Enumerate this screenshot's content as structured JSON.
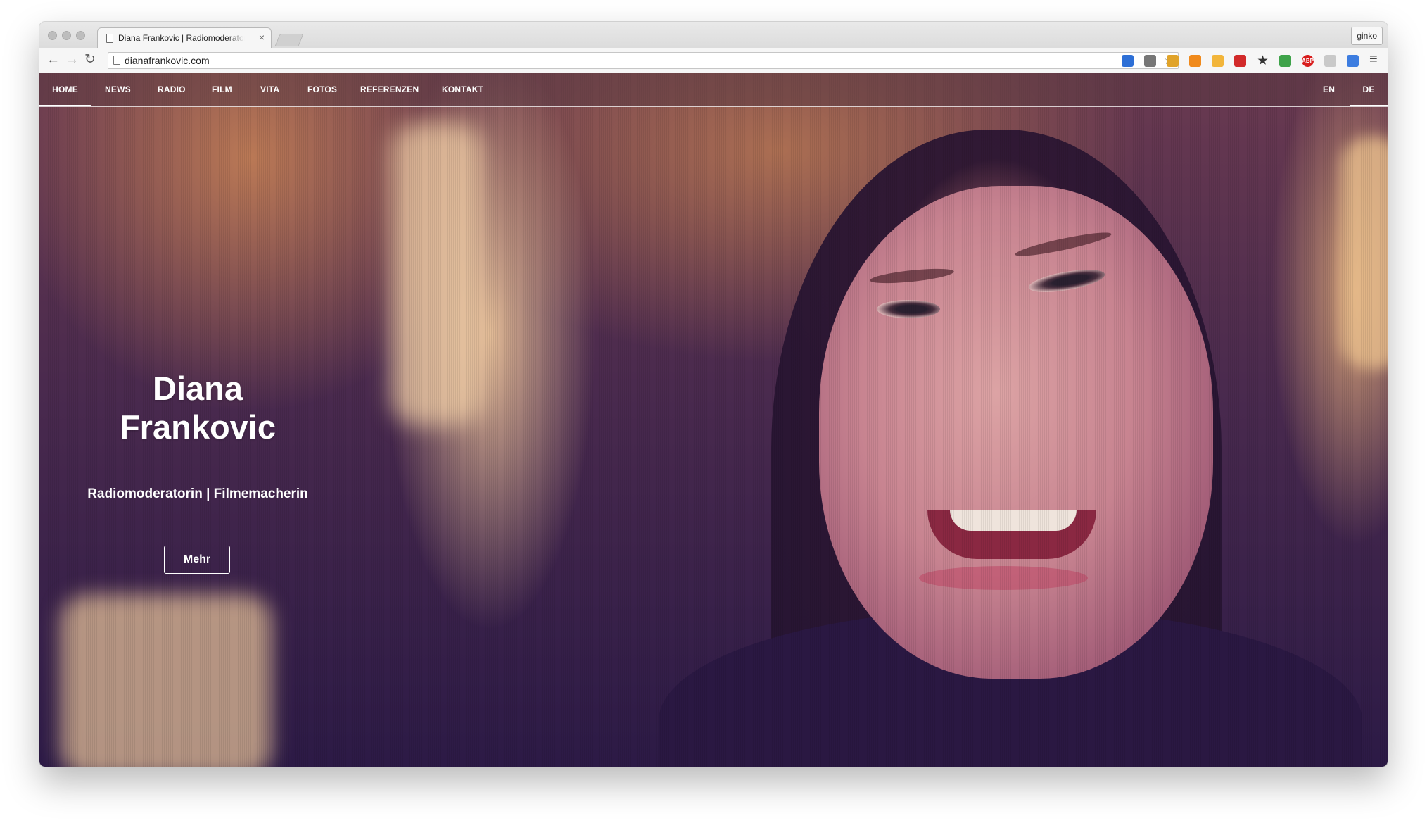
{
  "browser": {
    "tab_title": "Diana Frankovic | Radiomoderatorin",
    "tab_close": "×",
    "profile_name": "ginko",
    "url": "dianafrankovic.com",
    "back": "←",
    "forward": "→",
    "reload": "↻",
    "star": "☆",
    "menu": "≡",
    "extensions": [
      {
        "name": "blue-square-extension",
        "label": "",
        "color": "#2d6fd6"
      },
      {
        "name": "eyedropper-extension",
        "label": "",
        "color": "#777777"
      },
      {
        "name": "ruler-extension",
        "label": "",
        "color": "#e0a32a"
      },
      {
        "name": "chart-extension",
        "label": "",
        "color": "#f08a1c"
      },
      {
        "name": "face-extension",
        "label": "",
        "color": "#f2b53a"
      },
      {
        "name": "red-grid-extension",
        "label": "",
        "color": "#d22a2a"
      },
      {
        "name": "star-extension",
        "label": "★",
        "color": "#333333"
      },
      {
        "name": "color-extension",
        "label": "",
        "color": "#3fa34a"
      },
      {
        "name": "adblock-extension",
        "label": "ABP",
        "color": "#d81d1d"
      },
      {
        "name": "grey-extension",
        "label": "",
        "color": "#c9c9c9"
      },
      {
        "name": "blue-white-extension",
        "label": "",
        "color": "#3d7de0"
      }
    ]
  },
  "site": {
    "nav": [
      "HOME",
      "NEWS",
      "RADIO",
      "FILM",
      "VITA",
      "FOTOS",
      "REFERENZEN",
      "KONTAKT"
    ],
    "lang": [
      "EN",
      "DE"
    ],
    "hero_title": "Diana Frankovic",
    "hero_subtitle": "Radiomoderatorin | Filmemacherin",
    "hero_button": "Mehr"
  }
}
